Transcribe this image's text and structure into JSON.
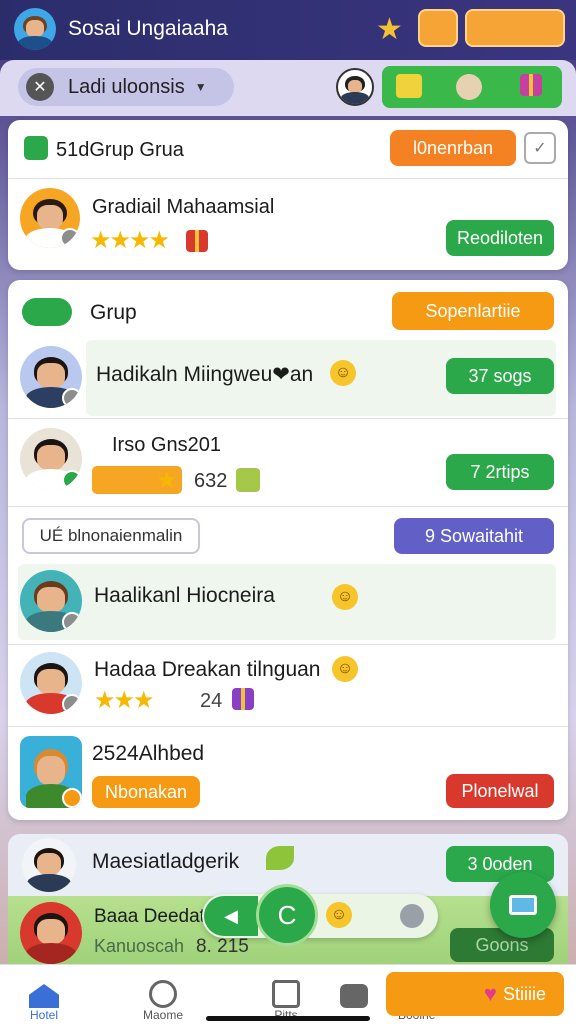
{
  "header": {
    "title": "Sosai Ungaiaaha"
  },
  "subheader": {
    "lang_label": "Ladi uloonsis"
  },
  "group1": {
    "title": "51dGrup Grua",
    "action": "l0nenrban",
    "member": {
      "name": "Gradiail Mahaamsial",
      "action": "Reodiloten"
    }
  },
  "group2": {
    "title": "Grup",
    "action": "Sopenlartiie",
    "rows": [
      {
        "name": "Hadikaln Miingweu❤an",
        "action": "37 sogs"
      },
      {
        "name": "Irso Gns201",
        "sub": "632",
        "action": "7 2rtips"
      }
    ],
    "filter_input": "UÉ blnonaienmalin",
    "filter_button": "9 Sowaitahit",
    "rows2": [
      {
        "name": "Haalikanl Hiocneira"
      },
      {
        "name": "Hadaa Dreakan tilnguan",
        "sub": "24"
      },
      {
        "name": "2524Alhbed",
        "tag1": "Nbonakan",
        "tag2": "Plonelwal"
      }
    ]
  },
  "group3": {
    "row1": {
      "name": "Maesiatladgerik",
      "action": "3 0oden"
    },
    "row2": {
      "name": "Baaa Deedat",
      "sub": "Kanuoscah",
      "num": "8. 215",
      "action": "Goons"
    }
  },
  "nav": {
    "home": "Hotel",
    "two": "Maome",
    "three": "Pitts",
    "four": "Booine",
    "cta": "Stiiiie"
  },
  "colors": {
    "primary_green": "#2aa84a",
    "accent_orange": "#f59a12",
    "accent_purple": "#6260c7",
    "accent_red": "#d9392c"
  }
}
